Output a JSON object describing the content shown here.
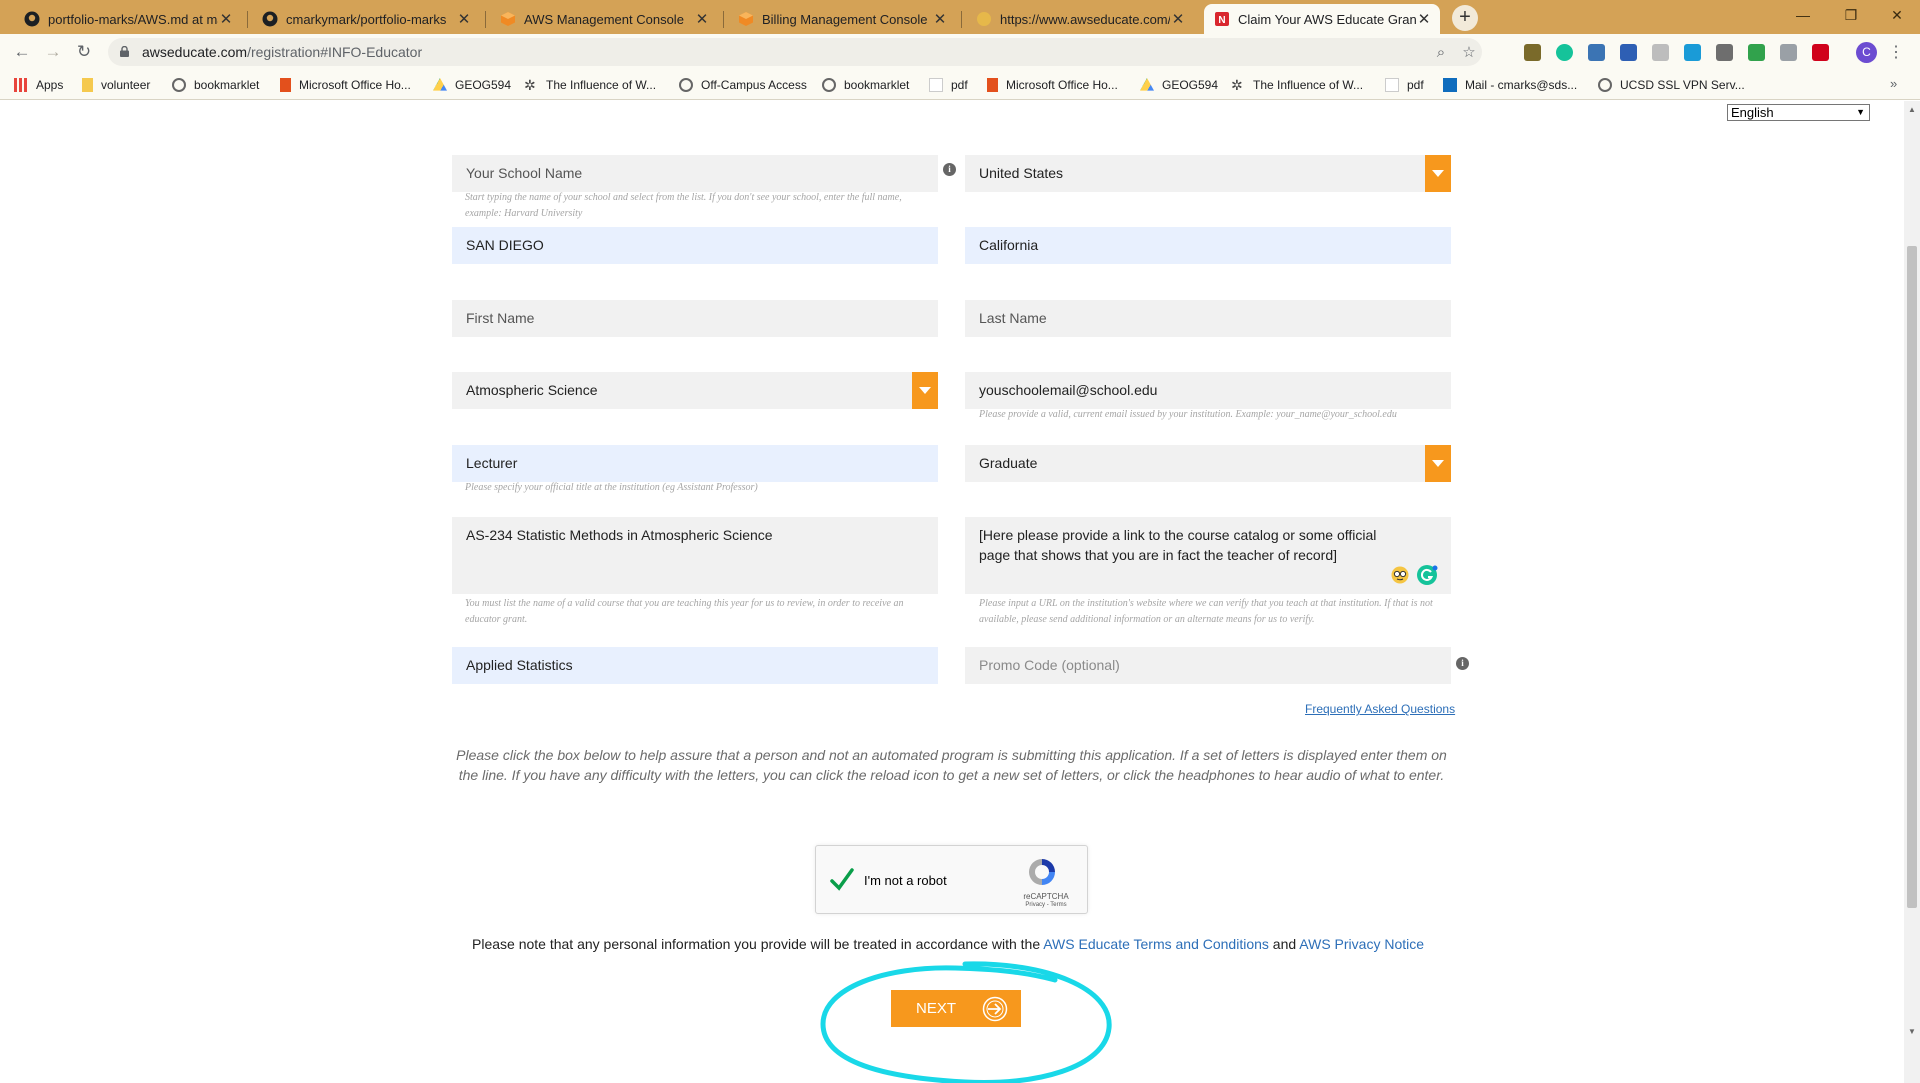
{
  "browser": {
    "tabs": [
      {
        "title": "portfolio-marks/AWS.md at mast",
        "icon": "github-icon"
      },
      {
        "title": "cmarkymark/portfolio-marks",
        "icon": "github-icon"
      },
      {
        "title": "AWS Management Console",
        "icon": "aws-cube-icon"
      },
      {
        "title": "Billing Management Console",
        "icon": "aws-cube-icon"
      },
      {
        "title": "https://www.awseducate.com/re",
        "icon": "loading-icon"
      },
      {
        "title": "Claim Your AWS Educate Grant | ",
        "icon": "news-icon",
        "active": true
      }
    ],
    "url_host": "awseducate.com",
    "url_path": "/registration#INFO-Educator",
    "profile_initial": "C",
    "bookmarks": [
      {
        "label": "Apps",
        "icon": "apps-grid-icon"
      },
      {
        "label": "volunteer",
        "icon": "folder-icon"
      },
      {
        "label": "bookmarklet",
        "icon": "globe-icon"
      },
      {
        "label": "Microsoft Office Ho...",
        "icon": "office-icon"
      },
      {
        "label": "GEOG594",
        "icon": "drive-icon"
      },
      {
        "label": "The Influence of W...",
        "icon": "gear-icon"
      },
      {
        "label": "Off-Campus Access",
        "icon": "globe-icon"
      },
      {
        "label": "bookmarklet",
        "icon": "globe-icon"
      },
      {
        "label": "pdf",
        "icon": "page-icon"
      },
      {
        "label": "Microsoft Office Ho...",
        "icon": "office-icon"
      },
      {
        "label": "GEOG594",
        "icon": "drive-icon"
      },
      {
        "label": "The Influence of W...",
        "icon": "gear-icon"
      },
      {
        "label": "pdf",
        "icon": "page-icon"
      },
      {
        "label": "Mail - cmarks@sds...",
        "icon": "outlook-icon"
      },
      {
        "label": "UCSD SSL VPN Serv...",
        "icon": "globe-icon"
      }
    ],
    "more_bookmarks": "»"
  },
  "page": {
    "language": "English",
    "form": {
      "school": {
        "placeholder": "Your School Name",
        "hint": "Start typing the name of your school and select from the list. If you don't see your school, enter the full name, example: Harvard University"
      },
      "country": {
        "value": "United States"
      },
      "city": {
        "value": "SAN DIEGO"
      },
      "state": {
        "value": "California"
      },
      "first_name": {
        "placeholder": "First Name"
      },
      "last_name": {
        "placeholder": "Last Name"
      },
      "department": {
        "value": "Atmospheric Science"
      },
      "email": {
        "value": "youschoolemail@school.edu",
        "hint": "Please provide a valid, current email issued by your institution. Example: your_name@your_school.edu"
      },
      "title": {
        "value": "Lecturer",
        "hint": "Please specify your official title at the institution (eg Assistant Professor)"
      },
      "level": {
        "value": "Graduate"
      },
      "course": {
        "value": "AS-234 Statistic Methods in Atmospheric Science",
        "hint": "You must list the name of a valid course that you are teaching this year for us to review, in order to receive an educator grant."
      },
      "course_url": {
        "value": "[Here please provide a link to the course catalog or some official page that shows that you are in fact the teacher of record]",
        "hint": "Please input a URL on the institution's website where we can verify that you teach at that institution. If that is not available, please send additional information or an alternate means for us to verify."
      },
      "field_of_study": {
        "value": "Applied Statistics"
      },
      "promo": {
        "placeholder": "Promo Code (optional)"
      }
    },
    "faq_link": "Frequently Asked Questions",
    "captcha_instructions": "Please click the box below to help assure that a person and not an automated program is submitting this application. If a set of letters is displayed enter them on the line. If you have any difficulty with the letters, you can click the reload icon to get a new set of letters, or click the headphones to hear audio of what to enter.",
    "recaptcha": {
      "label": "I'm not a robot",
      "brand": "reCAPTCHA",
      "terms": "Privacy - Terms",
      "checked": true
    },
    "notice": {
      "prefix": "Please note that any personal information you provide will be treated in accordance with the ",
      "terms_link": "AWS Educate Terms and Conditions",
      "and": " and ",
      "privacy_link": "AWS Privacy Notice"
    },
    "next_button": "NEXT",
    "colors": {
      "accent": "#f7981d",
      "link": "#2d6fb8",
      "annotation": "#19d8e8",
      "autofill": "#e8f0fe"
    }
  }
}
